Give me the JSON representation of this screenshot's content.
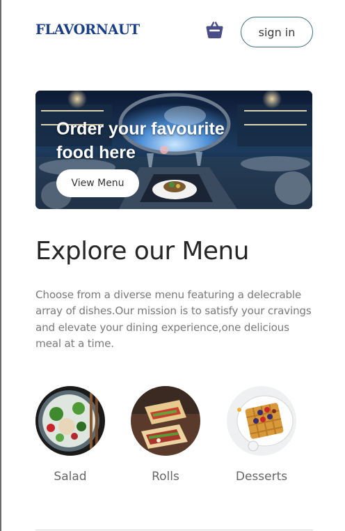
{
  "header": {
    "logo": "FLAVORNAUT",
    "cart_icon": "basket-icon",
    "sign_in_label": "sign in"
  },
  "hero": {
    "headline": "Order your favourite food here",
    "cta_label": "View Menu"
  },
  "explore": {
    "title": "Explore our Menu",
    "description": "Choose from a diverse menu featuring a delecrable array of dishes.Our mission is to satisfy your cravings and elevate your dining experience,one delicious meal at a time."
  },
  "categories": [
    {
      "label": "Salad"
    },
    {
      "label": "Rolls"
    },
    {
      "label": "Desserts"
    }
  ],
  "colors": {
    "brand": "#1b3f86",
    "basket": "#4a4e86",
    "button_border": "#3b6b7f",
    "body_text": "#7a7a7a"
  }
}
